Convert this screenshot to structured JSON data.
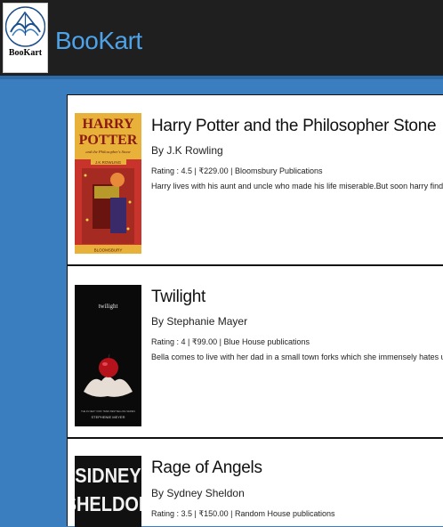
{
  "header": {
    "logo_text": "BooKart",
    "brand": "BooKart"
  },
  "books": [
    {
      "title": "Harry Potter and the Philosopher Stone",
      "author": "By J.K Rowling",
      "meta": "Rating : 4.5 | ₹229.00 | Bloomsbury Publications",
      "description": "Harry lives with his aunt and uncle who made his life miserable.But soon harry finds out that he is a wizard",
      "cover": {
        "line1": "HARRY",
        "line2": "POTTER",
        "subtitle": "and the Philosopher's Stone",
        "author": "J.K.ROWLING",
        "publisher": "BLOOMSBURY"
      }
    },
    {
      "title": "Twilight",
      "author": "By Stephanie Mayer",
      "meta": "Rating : 4 | ₹99.00 | Blue House publications",
      "description": "Bella comes to live with her dad in a small town forks which she immensely hates until she meets the charming",
      "cover": {
        "title": "twilight",
        "tagline": "THE #1 NEW YORK TIMES BESTSELLING SERIES",
        "author": "STEPHENIE MEYER"
      }
    },
    {
      "title": "Rage of Angels",
      "author": "By Sydney Sheldon",
      "meta": "Rating : 3.5 | ₹150.00 | Random House publications",
      "description": "",
      "cover": {
        "line1": "SIDNEY",
        "line2": "SHELDON"
      }
    }
  ],
  "colors": {
    "header_bg": "#1f1f1f",
    "page_bg": "#3a7ec0",
    "brand": "#4ea3e8"
  }
}
